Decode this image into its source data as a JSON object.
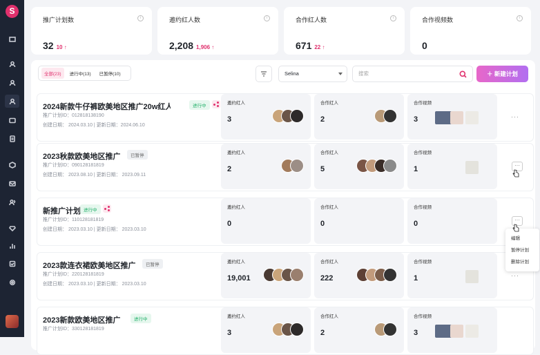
{
  "sidebar": {
    "logo": "S",
    "items": [
      "dashboard-icon",
      "user-icon",
      "users-icon",
      "user-active-icon",
      "folder-icon",
      "document-icon",
      "box-icon",
      "mail-icon",
      "people-icon",
      "diamond-icon",
      "chart-icon",
      "check-icon",
      "settings-icon"
    ]
  },
  "stats": [
    {
      "label": "推广计划数",
      "value": "32",
      "delta": "10 ↑"
    },
    {
      "label": "邀约红人数",
      "value": "2,208",
      "delta": "1,906 ↑"
    },
    {
      "label": "合作红人数",
      "value": "671",
      "delta": "22 ↑"
    },
    {
      "label": "合作视频数",
      "value": "0",
      "delta": ""
    }
  ],
  "toolbar": {
    "tabs": [
      "全部(23)",
      "进行中(13)",
      "已暂停(10)"
    ],
    "select_value": "Selina",
    "search_placeholder": "搜索",
    "new_button": "新建计划"
  },
  "cards": [
    {
      "title": "2024新款牛仔裤欧美地区推广20w红人...",
      "badge": "进行中",
      "badge_type": "go",
      "id": "推广计划ID：012818138190",
      "dates": "创建日期：  2024.03.10 | 更新日期：2024.06.10",
      "c1": "邀约红人",
      "v1": "3",
      "c2": "合作红人",
      "v2": "2",
      "c3": "合作视频",
      "v3": "3"
    },
    {
      "title": "2023秋款欧美地区推广",
      "badge": "已暂停",
      "badge_type": "stop",
      "id": "推广计划ID：090128181819",
      "dates": "创建日期：  2023.08.10 | 更新日期：  2023.09.11",
      "c1": "邀约红人",
      "v1": "2",
      "c2": "合作红人",
      "v2": "5",
      "c3": "合作视频",
      "v3": "1"
    },
    {
      "title": "新推广计划",
      "badge": "进行中",
      "badge_type": "go",
      "id": "推广计划ID：110128181819",
      "dates": "创建日期：  2023.03.10 | 更新日期：  2023.03.10",
      "c1": "邀约红人",
      "v1": "0",
      "c2": "合作红人",
      "v2": "0",
      "c3": "合作视频",
      "v3": "0"
    },
    {
      "title": "2023款连衣裙欧美地区推广",
      "badge": "已暂停",
      "badge_type": "stop",
      "id": "推广计划ID：220128181819",
      "dates": "创建日期：  2023.03.10 | 更新日期：  2023.03.10",
      "c1": "邀约红人",
      "v1": "19,001",
      "c2": "合作红人",
      "v2": "222",
      "c3": "合作视频",
      "v3": "1"
    },
    {
      "title": "2023新款欧美地区推广",
      "badge": "进行中",
      "badge_type": "go",
      "id": "推广计划ID：330128181819",
      "dates": "",
      "c1": "邀约红人",
      "v1": "3",
      "c2": "合作红人",
      "v2": "2",
      "c3": "合作视频",
      "v3": "3"
    }
  ],
  "menu": [
    "编辑",
    "暂停计划",
    "删除计划"
  ],
  "colors": {
    "accent": "#e0306d",
    "sidebar": "#1d2433",
    "running": "#23b06a"
  }
}
